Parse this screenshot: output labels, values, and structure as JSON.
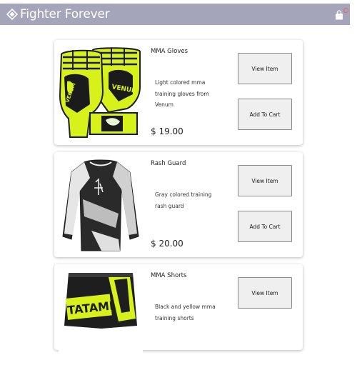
{
  "header": {
    "brand": "Fighter Forever",
    "logo_icon": "diamond-logo-icon",
    "cart_icon": "shopping-bag-icon",
    "bar_color": "#a4a4ba"
  },
  "products": [
    {
      "title": "MMA Gloves",
      "description": "Light colored mma training gloves from Venum",
      "price": "$ 19.00",
      "view_label": "View Item",
      "add_label": "Add To Cart",
      "image_icon": "mma-gloves-image"
    },
    {
      "title": "Rash Guard",
      "description": "Gray colored training rash guard",
      "price": "$ 20.00",
      "view_label": "View Item",
      "add_label": "Add To Cart",
      "image_icon": "rash-guard-image"
    },
    {
      "title": "MMA Shorts",
      "description": "Black and yellow mma training shorts",
      "view_label": "View Item",
      "image_icon": "mma-shorts-image"
    }
  ]
}
